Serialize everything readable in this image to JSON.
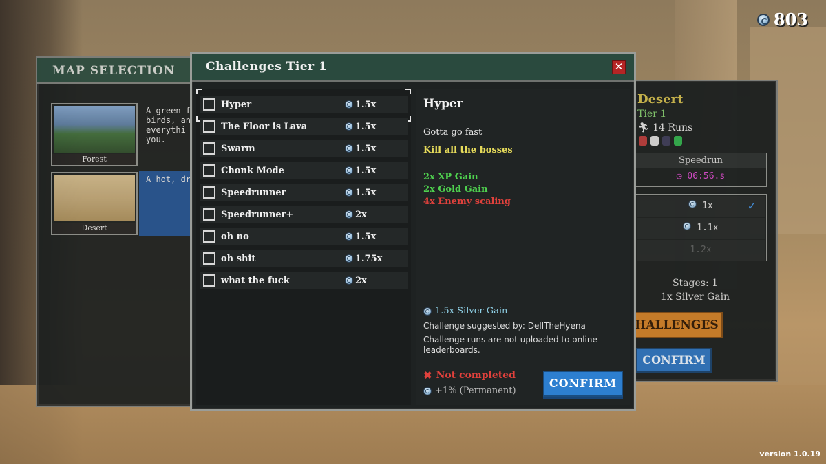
{
  "currency": {
    "icon": "silver-coin-icon",
    "value": "803"
  },
  "map_selection": {
    "title": "MAP SELECTION",
    "maps": [
      {
        "name": "Forest",
        "desc": "A green f\nbirds, and\neverythi\nyou."
      },
      {
        "name": "Desert",
        "desc": "A hot, dry"
      }
    ]
  },
  "right_panel": {
    "map_title": "Desert",
    "tier": "Tier 1",
    "runs": "14 Runs",
    "speedrun_label": "Speedrun",
    "speedrun_time": "06:56.s",
    "difficulties": [
      "1x",
      "1.1x",
      "1.2x"
    ],
    "stages": "Stages: 1",
    "silver_gain": "1x Silver Gain",
    "challenges_button": "HALLENGES",
    "confirm_button": "CONFIRM"
  },
  "dialog": {
    "title": "Challenges Tier 1",
    "challenges": [
      {
        "name": "Hyper",
        "mult": "1.5x"
      },
      {
        "name": "The Floor is Lava",
        "mult": "1.5x"
      },
      {
        "name": "Swarm",
        "mult": "1.5x"
      },
      {
        "name": "Chonk Mode",
        "mult": "1.5x"
      },
      {
        "name": "Speedrunner",
        "mult": "1.5x"
      },
      {
        "name": "Speedrunner+",
        "mult": "2x"
      },
      {
        "name": "oh no",
        "mult": "1.5x"
      },
      {
        "name": "oh shit",
        "mult": "1.75x"
      },
      {
        "name": "what the fuck",
        "mult": "2x"
      }
    ],
    "detail": {
      "title": "Hyper",
      "description": "Gotta go fast",
      "goal": "Kill all the bosses",
      "modifiers": [
        {
          "text": "2x XP Gain",
          "kind": "good"
        },
        {
          "text": "2x Gold Gain",
          "kind": "good"
        },
        {
          "text": "4x Enemy scaling",
          "kind": "bad"
        }
      ],
      "silver_gain": "1.5x Silver Gain",
      "suggested_by": "Challenge suggested by: DellTheHyena",
      "note": "Challenge runs are not uploaded to online leaderboards.",
      "status": "Not completed",
      "permanent": "+1% (Permanent)",
      "confirm_button": "CONFIRM"
    }
  },
  "version": "version 1.0.19",
  "colors": {
    "header_green": "#2a4a3e",
    "confirm_blue": "#2d7fd0",
    "good_green": "#4fd14f",
    "bad_red": "#e0413c",
    "goal_yellow": "#e5da5a",
    "silver_cyan": "#8fd0e6"
  }
}
